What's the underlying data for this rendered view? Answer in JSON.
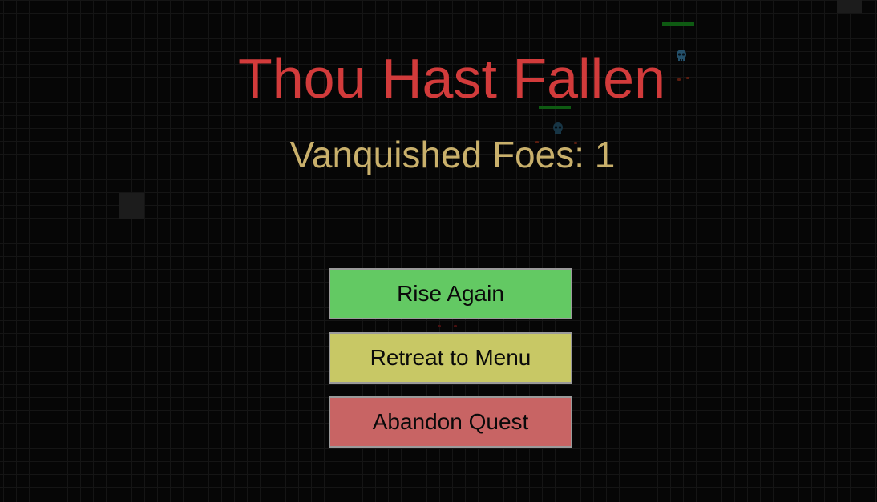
{
  "screen": {
    "title": "Thou Hast Fallen",
    "score_label": "Vanquished Foes: 1",
    "title_color": "#d23b3b",
    "score_color": "#c9b06b",
    "background_color": "#060606"
  },
  "menu": {
    "buttons": [
      {
        "label": "Rise Again",
        "color": "#63c963"
      },
      {
        "label": "Retreat to Menu",
        "color": "#c8c865"
      },
      {
        "label": "Abandon Quest",
        "color": "#c86464"
      }
    ]
  },
  "background_scene": {
    "enemies": [
      {
        "icon": "skull-icon",
        "health_bar_color": "#0e5a12"
      },
      {
        "icon": "skull-icon",
        "health_bar_color": "#0e5a12"
      }
    ],
    "floor_tiles": 2
  }
}
